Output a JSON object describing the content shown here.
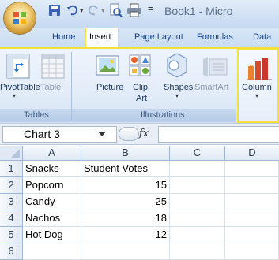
{
  "window": {
    "title": "Book1 - Micro"
  },
  "tabs": [
    {
      "label": "Home"
    },
    {
      "label": "Insert"
    },
    {
      "label": "Page Layout"
    },
    {
      "label": "Formulas"
    },
    {
      "label": "Data"
    }
  ],
  "ribbon": {
    "groups": {
      "tables": "Tables",
      "illustrations": "Illustrations"
    },
    "commands": {
      "pivottable": "PivotTable",
      "table": "Table",
      "picture": "Picture",
      "clip_art_line1": "Clip",
      "clip_art_line2": "Art",
      "shapes": "Shapes",
      "smartart": "SmartArt",
      "column": "Column"
    }
  },
  "formula_bar": {
    "name_box": "Chart 3",
    "fx_label": "fx",
    "value": ""
  },
  "sheet": {
    "columns": [
      "A",
      "B",
      "C",
      "D"
    ],
    "rows": [
      {
        "num": "1",
        "a": "Snacks",
        "b": "Student Votes"
      },
      {
        "num": "2",
        "a": "Popcorn",
        "b": "15"
      },
      {
        "num": "3",
        "a": "Candy",
        "b": "25"
      },
      {
        "num": "4",
        "a": "Nachos",
        "b": "18"
      },
      {
        "num": "5",
        "a": "Hot Dog",
        "b": "12"
      },
      {
        "num": "6",
        "a": "",
        "b": ""
      }
    ]
  },
  "colors": {
    "highlight": "#f3e13a",
    "ribbon_text": "#15428b"
  }
}
